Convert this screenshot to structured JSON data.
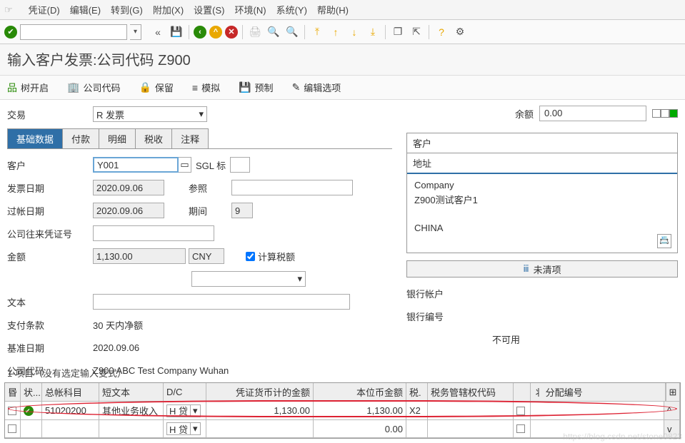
{
  "menu": [
    "凭证(D)",
    "编辑(E)",
    "转到(G)",
    "附加(X)",
    "设置(S)",
    "环境(N)",
    "系统(Y)",
    "帮助(H)"
  ],
  "page_title": "输入客户发票:公司代码 Z900",
  "toolbar2": {
    "tree_on": "树开启",
    "company": "公司代码",
    "hold": "保留",
    "simulate": "模拟",
    "park": "预制",
    "edit_opts": "编辑选项"
  },
  "trans": {
    "label": "交易",
    "value": "R 发票"
  },
  "tabs": [
    "基础数据",
    "付款",
    "明细",
    "税收",
    "注释"
  ],
  "form": {
    "customer_label": "客户",
    "customer_value": "Y001",
    "sgl_label": "SGL 标",
    "inv_date_label": "发票日期",
    "inv_date": "2020.09.06",
    "ref_label": "参照",
    "post_date_label": "过帐日期",
    "post_date": "2020.09.06",
    "period_label": "期间",
    "period": "9",
    "xref_label": "公司往来凭证号",
    "amount_label": "金额",
    "amount": "1,130.00",
    "curr": "CNY",
    "calc_tax": "计算税额",
    "text_label": "文本",
    "payterm_label": "支付条款",
    "payterm_val": "30 天内净额",
    "baseline_label": "基准日期",
    "baseline_val": "2020.09.06",
    "cocode_label": "公司代码",
    "cocode_val": "Z900 ABC Test Company Wuhan"
  },
  "balance": {
    "label": "余额",
    "value": "0.00"
  },
  "cust": {
    "header": "客户",
    "tab": "地址",
    "name": "Company",
    "line2": "Z900测试客户1",
    "country": "CHINA",
    "open_items": "未清项",
    "bank_acct": "银行帐户",
    "bank_no": "银行编号",
    "not_avail": "不可用"
  },
  "items_caption": "1 项目（没有选定输入变式）",
  "grid_head": {
    "stat": "状...",
    "gl": "总帐科目",
    "short": "短文本",
    "dc": "D/C",
    "amt1": "凭证货币计的金额",
    "amt2": "本位币金额",
    "tax": "税.",
    "juris": "税务管辖权代码",
    "assign": "丬 分配编号"
  },
  "grid_rows": [
    {
      "gl": "51020200",
      "short": "其他业务收入",
      "dc": "H 贷",
      "amt1": "1,130.00",
      "amt2": "1,130.00",
      "tax": "X2"
    },
    {
      "gl": "",
      "short": "",
      "dc": "H 贷",
      "amt1": "",
      "amt2": "0.00",
      "tax": ""
    }
  ],
  "watermark": "https://blog.csdn.net/stone0823"
}
